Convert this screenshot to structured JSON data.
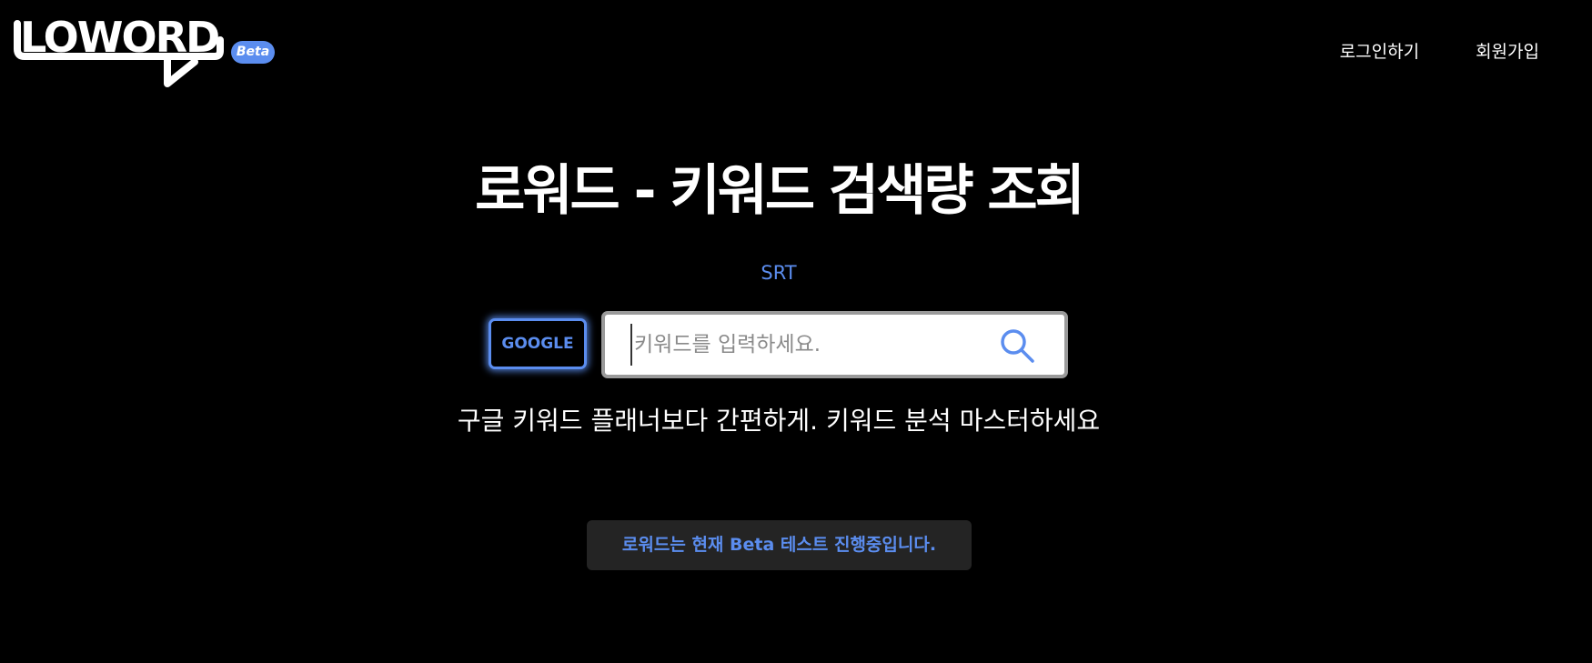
{
  "header": {
    "logo_text": "LOWORD",
    "beta_badge": "Beta",
    "nav": {
      "login": "로그인하기",
      "signup": "회원가입"
    }
  },
  "hero": {
    "title": "로워드 - 키워드 검색량 조회",
    "subtitle": "SRT"
  },
  "search": {
    "engine_label": "GOOGLE",
    "placeholder": "키워드를 입력하세요.",
    "value": ""
  },
  "tagline": "구글 키워드 플래너보다 간편하게. 키워드 분석 마스터하세요",
  "notice": "로워드는 현재 Beta 테스트 진행중입니다.",
  "colors": {
    "background": "#000000",
    "accent": "#5b8def",
    "notice_bg": "#242424"
  },
  "icons": {
    "search": "search-icon",
    "logo": "speech-bubble-logo"
  }
}
